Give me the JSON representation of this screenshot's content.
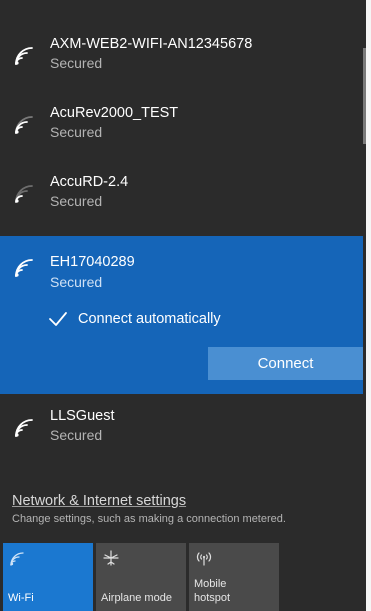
{
  "networks": [
    {
      "ssid": "AXM-WEB2-WIFI-AN12345678",
      "status": "Secured",
      "icon": "wifi-signal-icon"
    },
    {
      "ssid": "AcuRev2000_TEST",
      "status": "Secured",
      "icon": "wifi-signal-icon"
    },
    {
      "ssid": "AccuRD-2.4",
      "status": "Secured",
      "icon": "wifi-signal-icon"
    }
  ],
  "selected_network": {
    "ssid": "EH17040289",
    "status": "Secured",
    "connect_automatically_label": "Connect automatically",
    "connect_automatically_checked": true,
    "connect_button_label": "Connect"
  },
  "after_networks": [
    {
      "ssid": "LLSGuest",
      "status": "Secured",
      "icon": "wifi-signal-icon"
    }
  ],
  "settings": {
    "link_label": "Network & Internet settings",
    "description": "Change settings, such as making a connection metered."
  },
  "quick_actions": [
    {
      "label": "Wi-Fi",
      "icon": "wifi-icon",
      "active": true
    },
    {
      "label": "Airplane mode",
      "icon": "airplane-icon",
      "active": false
    },
    {
      "label": "Mobile hotspot",
      "icon": "mobile-hotspot-icon",
      "active": false
    }
  ],
  "colors": {
    "panel_bg": "#2b2b2b",
    "accent": "#1565b8",
    "tile_active": "#1b78d0",
    "tile_inactive": "#4a4a4a"
  }
}
